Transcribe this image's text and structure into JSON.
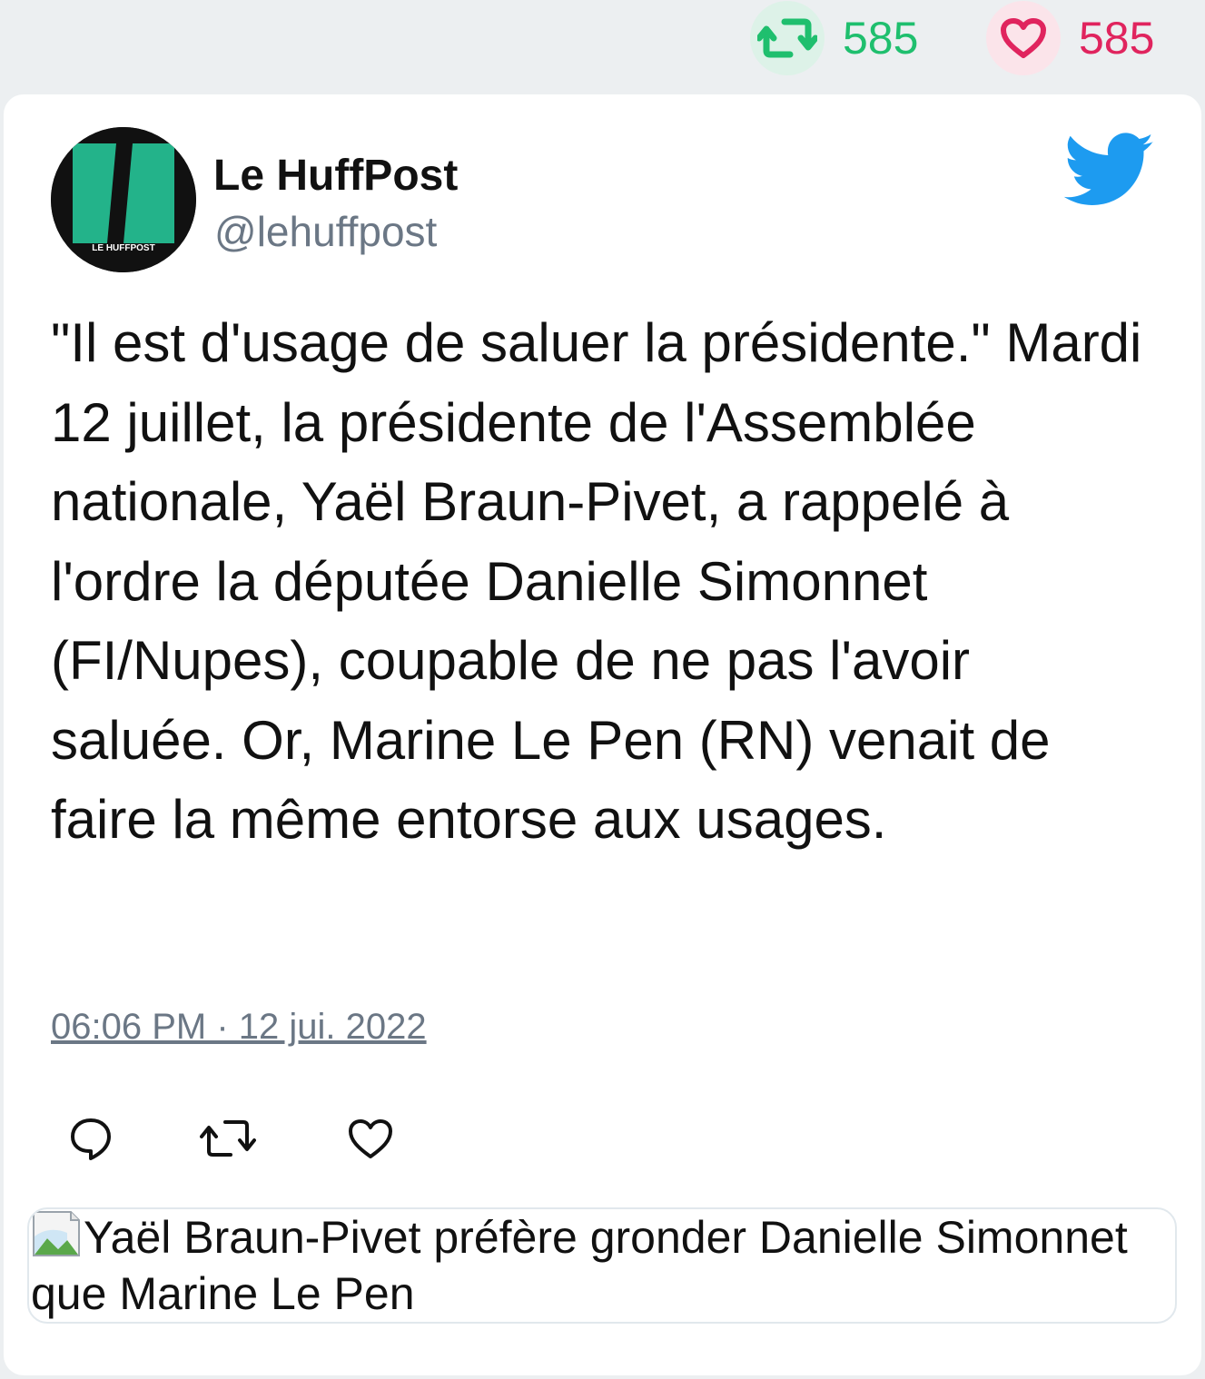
{
  "stats": {
    "retweets": "585",
    "likes": "585",
    "retweet_icon": "retweet-icon",
    "like_icon": "heart-icon",
    "retweet_color": "#1fbf6e",
    "like_color": "#e0245e"
  },
  "author": {
    "name": "Le HuffPost",
    "handle": "@lehuffpost",
    "avatar_text": "LE HUFFPOST",
    "avatar_colors": {
      "background": "#111111",
      "logo": "#23b38a"
    }
  },
  "platform_icon": "twitter-bird-icon",
  "platform_color": "#1d9bf0",
  "tweet": {
    "text": "\"Il est d'usage de saluer la présidente.\" Mardi 12 juillet, la présidente de l'Assemblée nationale, Yaël Braun-Pivet, a rappelé à l'ordre la députée Danielle Simonnet (FI/Nupes), coupable de ne pas l'avoir saluée. Or, Marine Le Pen (RN) venait de faire la même entorse aux usages.",
    "timestamp": "06:06 PM · 12 jui. 2022"
  },
  "actions": [
    {
      "icon": "reply-icon"
    },
    {
      "icon": "retweet-icon"
    },
    {
      "icon": "like-icon"
    }
  ],
  "preview": {
    "alt_text": "Yaël Braun-Pivet préfère gronder Danielle Simonnet que Marine Le Pen",
    "icon": "broken-image-icon"
  }
}
